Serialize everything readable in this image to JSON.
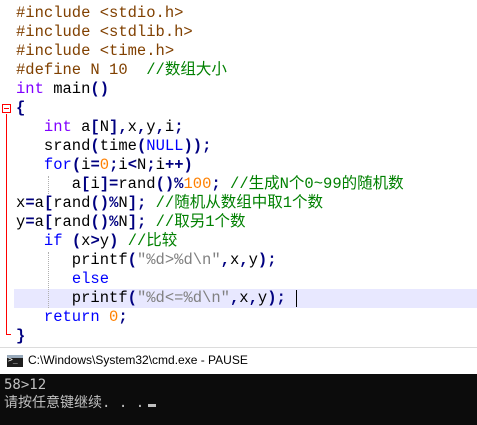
{
  "editor": {
    "lines": [
      {
        "parts": [
          {
            "c": "pp",
            "t": "#include <stdio.h>"
          }
        ]
      },
      {
        "parts": [
          {
            "c": "pp",
            "t": "#include <stdlib.h>"
          }
        ]
      },
      {
        "parts": [
          {
            "c": "pp",
            "t": "#include <time.h>"
          }
        ]
      },
      {
        "parts": [
          {
            "c": "pp",
            "t": "#define N 10  "
          },
          {
            "c": "cm",
            "t": "//数组大小"
          }
        ]
      },
      {
        "parts": [
          {
            "c": "ty",
            "t": "int"
          },
          {
            "c": "id",
            "t": " main"
          },
          {
            "c": "op",
            "t": "()"
          }
        ]
      },
      {
        "parts": [
          {
            "c": "brace",
            "t": "{"
          }
        ]
      },
      {
        "parts": [
          {
            "c": "id",
            "t": "   "
          },
          {
            "c": "ty",
            "t": "int"
          },
          {
            "c": "id",
            "t": " a"
          },
          {
            "c": "op",
            "t": "["
          },
          {
            "c": "id",
            "t": "N"
          },
          {
            "c": "op",
            "t": "],"
          },
          {
            "c": "id",
            "t": "x"
          },
          {
            "c": "op",
            "t": ","
          },
          {
            "c": "id",
            "t": "y"
          },
          {
            "c": "op",
            "t": ","
          },
          {
            "c": "id",
            "t": "i"
          },
          {
            "c": "op",
            "t": ";"
          }
        ]
      },
      {
        "parts": [
          {
            "c": "id",
            "t": "   srand"
          },
          {
            "c": "op",
            "t": "("
          },
          {
            "c": "id",
            "t": "time"
          },
          {
            "c": "op",
            "t": "("
          },
          {
            "c": "kw",
            "t": "NULL"
          },
          {
            "c": "op",
            "t": "));"
          }
        ]
      },
      {
        "parts": [
          {
            "c": "id",
            "t": "   "
          },
          {
            "c": "kw",
            "t": "for"
          },
          {
            "c": "op",
            "t": "("
          },
          {
            "c": "id",
            "t": "i"
          },
          {
            "c": "op",
            "t": "="
          },
          {
            "c": "num",
            "t": "0"
          },
          {
            "c": "op",
            "t": ";"
          },
          {
            "c": "id",
            "t": "i"
          },
          {
            "c": "op",
            "t": "<"
          },
          {
            "c": "id",
            "t": "N"
          },
          {
            "c": "op",
            "t": ";"
          },
          {
            "c": "id",
            "t": "i"
          },
          {
            "c": "op",
            "t": "++)"
          }
        ]
      },
      {
        "parts": [
          {
            "c": "id",
            "t": "      a"
          },
          {
            "c": "op",
            "t": "["
          },
          {
            "c": "id",
            "t": "i"
          },
          {
            "c": "op",
            "t": "]="
          },
          {
            "c": "id",
            "t": "rand"
          },
          {
            "c": "op",
            "t": "()%"
          },
          {
            "c": "num",
            "t": "100"
          },
          {
            "c": "op",
            "t": ";"
          },
          {
            "c": "id",
            "t": " "
          },
          {
            "c": "cm",
            "t": "//生成N个0~99的随机数"
          }
        ]
      },
      {
        "parts": [
          {
            "c": "id",
            "t": "x"
          },
          {
            "c": "op",
            "t": "="
          },
          {
            "c": "id",
            "t": "a"
          },
          {
            "c": "op",
            "t": "["
          },
          {
            "c": "id",
            "t": "rand"
          },
          {
            "c": "op",
            "t": "()%"
          },
          {
            "c": "id",
            "t": "N"
          },
          {
            "c": "op",
            "t": "];"
          },
          {
            "c": "id",
            "t": " "
          },
          {
            "c": "cm",
            "t": "//随机从数组中取1个数"
          }
        ]
      },
      {
        "parts": [
          {
            "c": "id",
            "t": "y"
          },
          {
            "c": "op",
            "t": "="
          },
          {
            "c": "id",
            "t": "a"
          },
          {
            "c": "op",
            "t": "["
          },
          {
            "c": "id",
            "t": "rand"
          },
          {
            "c": "op",
            "t": "()%"
          },
          {
            "c": "id",
            "t": "N"
          },
          {
            "c": "op",
            "t": "];"
          },
          {
            "c": "id",
            "t": " "
          },
          {
            "c": "cm",
            "t": "//取另1个数"
          }
        ]
      },
      {
        "parts": [
          {
            "c": "id",
            "t": "   "
          },
          {
            "c": "kw",
            "t": "if"
          },
          {
            "c": "id",
            "t": " "
          },
          {
            "c": "op",
            "t": "("
          },
          {
            "c": "id",
            "t": "x"
          },
          {
            "c": "op",
            "t": ">"
          },
          {
            "c": "id",
            "t": "y"
          },
          {
            "c": "op",
            "t": ")"
          },
          {
            "c": "id",
            "t": " "
          },
          {
            "c": "cm",
            "t": "//比较"
          }
        ]
      },
      {
        "parts": [
          {
            "c": "id",
            "t": "      printf"
          },
          {
            "c": "op",
            "t": "("
          },
          {
            "c": "str",
            "t": "\"%d>%d\\n\""
          },
          {
            "c": "op",
            "t": ","
          },
          {
            "c": "id",
            "t": "x"
          },
          {
            "c": "op",
            "t": ","
          },
          {
            "c": "id",
            "t": "y"
          },
          {
            "c": "op",
            "t": ");"
          }
        ]
      },
      {
        "parts": [
          {
            "c": "id",
            "t": "      "
          },
          {
            "c": "kw",
            "t": "else"
          }
        ]
      },
      {
        "parts": [
          {
            "c": "id",
            "t": "      printf"
          },
          {
            "c": "op",
            "t": "("
          },
          {
            "c": "str",
            "t": "\"%d<=%d\\n\""
          },
          {
            "c": "op",
            "t": ","
          },
          {
            "c": "id",
            "t": "x"
          },
          {
            "c": "op",
            "t": ","
          },
          {
            "c": "id",
            "t": "y"
          },
          {
            "c": "op",
            "t": ");"
          }
        ]
      },
      {
        "parts": [
          {
            "c": "id",
            "t": "   "
          },
          {
            "c": "kw",
            "t": "return"
          },
          {
            "c": "id",
            "t": " "
          },
          {
            "c": "num",
            "t": "0"
          },
          {
            "c": "op",
            "t": ";"
          }
        ]
      },
      {
        "parts": [
          {
            "c": "brace",
            "t": "}"
          }
        ]
      }
    ]
  },
  "console": {
    "title": "C:\\Windows\\System32\\cmd.exe - PAUSE",
    "output_line1": "58>12",
    "output_line2": "请按任意键继续. . ."
  }
}
